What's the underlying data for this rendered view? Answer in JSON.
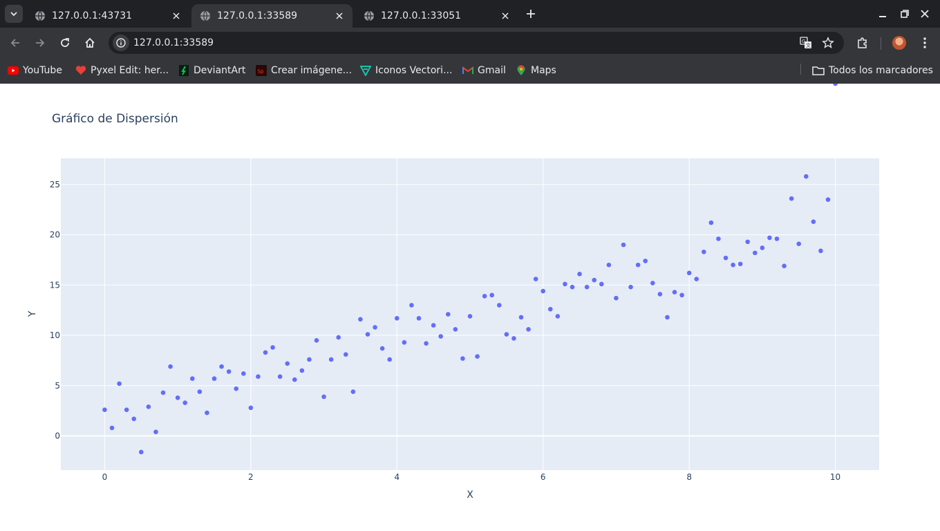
{
  "browser": {
    "tabs": [
      {
        "title": "127.0.0.1:43731",
        "active": false
      },
      {
        "title": "127.0.0.1:33589",
        "active": true
      },
      {
        "title": "127.0.0.1:33051",
        "active": false
      }
    ],
    "url": "127.0.0.1:33589",
    "bookmarks": [
      {
        "label": "YouTube",
        "icon": "youtube-icon"
      },
      {
        "label": "Pyxel Edit: her...",
        "icon": "pyxel-icon"
      },
      {
        "label": "DeviantArt",
        "icon": "deviantart-icon"
      },
      {
        "label": "Crear imágene...",
        "icon": "sp-icon"
      },
      {
        "label": "Iconos Vectori...",
        "icon": "flaticon-icon"
      },
      {
        "label": "Gmail",
        "icon": "gmail-icon"
      },
      {
        "label": "Maps",
        "icon": "maps-icon"
      }
    ],
    "all_bookmarks_label": "Todos los marcadores",
    "colors": {
      "tab_bg": "#202124",
      "toolbar_bg": "#35363a",
      "text": "#e8eaed"
    }
  },
  "chart_data": {
    "type": "scatter",
    "title": "Gráfico de Dispersión",
    "xlabel": "X",
    "ylabel": "Y",
    "xlim": [
      -0.6,
      10.6
    ],
    "ylim": [
      -3.4,
      27.6
    ],
    "x_ticks": [
      0,
      2,
      4,
      6,
      8,
      10
    ],
    "y_ticks": [
      0,
      5,
      10,
      15,
      20,
      25
    ],
    "grid": true,
    "marker_color": "#636efa",
    "plot_bg": "#e5ecf6",
    "x": [
      0.0,
      0.1,
      0.2,
      0.3,
      0.4,
      0.5,
      0.6,
      0.7,
      0.8,
      0.9,
      1.0,
      1.1,
      1.2,
      1.3,
      1.4,
      1.5,
      1.6,
      1.7,
      1.8,
      1.9,
      2.0,
      2.1,
      2.2,
      2.3,
      2.4,
      2.5,
      2.6,
      2.7,
      2.8,
      2.9,
      3.0,
      3.1,
      3.2,
      3.3,
      3.4,
      3.5,
      3.6,
      3.7,
      3.8,
      3.9,
      4.0,
      4.1,
      4.2,
      4.3,
      4.4,
      4.5,
      4.6,
      4.7,
      4.8,
      4.9,
      5.0,
      5.1,
      5.2,
      5.3,
      5.4,
      5.5,
      5.6,
      5.7,
      5.8,
      5.9,
      6.0,
      6.1,
      6.2,
      6.3,
      6.4,
      6.5,
      6.6,
      6.7,
      6.8,
      6.9,
      7.0,
      7.1,
      7.2,
      7.3,
      7.4,
      7.5,
      7.6,
      7.7,
      7.8,
      7.9,
      8.0,
      8.1,
      8.2,
      8.3,
      8.4,
      8.5,
      8.6,
      8.7,
      8.8,
      8.9,
      9.0,
      9.1,
      9.2,
      9.3,
      9.4,
      9.5,
      9.6,
      9.7,
      9.8,
      9.9,
      10.0
    ],
    "y": [
      2.6,
      0.8,
      5.2,
      2.6,
      1.7,
      -1.6,
      2.9,
      0.4,
      4.3,
      6.9,
      3.8,
      3.3,
      5.7,
      4.4,
      2.3,
      5.7,
      6.9,
      6.4,
      4.7,
      6.2,
      2.8,
      5.9,
      8.3,
      8.8,
      5.9,
      7.2,
      5.6,
      6.5,
      7.6,
      9.5,
      3.9,
      7.6,
      9.8,
      8.1,
      4.4,
      11.6,
      10.1,
      10.8,
      8.7,
      7.6,
      11.7,
      9.3,
      13.0,
      11.7,
      9.2,
      11.0,
      9.9,
      12.1,
      10.6,
      7.7,
      11.9,
      7.9,
      13.9,
      14.0,
      13.0,
      10.1,
      9.7,
      11.8,
      10.6,
      15.6,
      14.4,
      12.6,
      11.9,
      15.1,
      14.8,
      16.1,
      14.8,
      15.5,
      15.1,
      17.0,
      13.7,
      19.0,
      14.8,
      17.0,
      17.4,
      15.2,
      14.1,
      11.8,
      14.3,
      14.0,
      16.2,
      15.6,
      18.3,
      21.2,
      19.6,
      17.7,
      17.0,
      17.1,
      19.3,
      18.2,
      18.7,
      19.7,
      19.6,
      16.9,
      23.6,
      19.1,
      25.8,
      21.3,
      18.4,
      23.5
    ]
  }
}
